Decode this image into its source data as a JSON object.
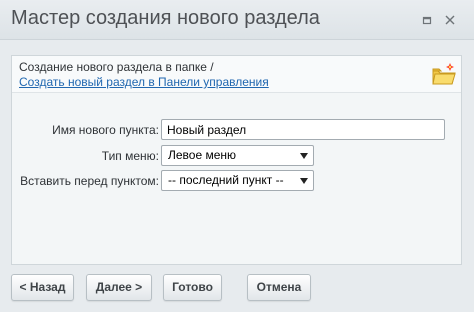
{
  "dialog": {
    "title": "Мастер создания нового раздела",
    "controls": {
      "restore_icon": "restore-icon",
      "close_icon": "close-icon"
    }
  },
  "header": {
    "text": "Создание нового раздела в папке /",
    "link": "Создать новый раздел в Панели управления",
    "folder_icon": "new-folder-icon"
  },
  "form": {
    "name_label": "Имя нового пункта:",
    "name_value": "Новый раздел",
    "menu_type_label": "Тип меню:",
    "menu_type_value": "Левое меню",
    "insert_before_label": "Вставить перед пунктом:",
    "insert_before_value": "-- последний пункт --"
  },
  "buttons": {
    "back": "< Назад",
    "next": "Далее >",
    "done": "Готово",
    "cancel": "Отмена"
  },
  "colors": {
    "title_text": "#4e5155",
    "link": "#2067b0",
    "panel_bg": "#f3f6f7",
    "dialog_bg": "#e7ebee"
  }
}
